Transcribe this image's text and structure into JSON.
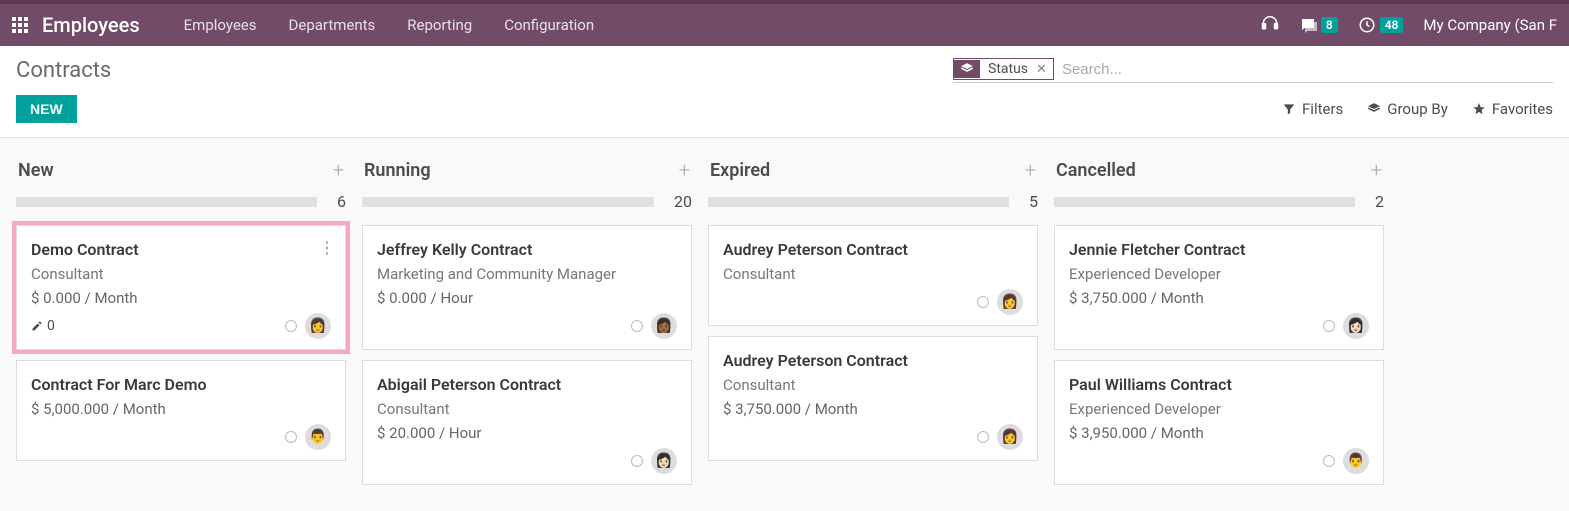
{
  "topbar": {
    "brand": "Employees",
    "nav": [
      "Employees",
      "Departments",
      "Reporting",
      "Configuration"
    ],
    "messages_badge": "8",
    "activities_badge": "48",
    "company": "My Company (San F"
  },
  "control_panel": {
    "breadcrumb": "Contracts",
    "new_btn": "NEW",
    "search_facet_label": "Status",
    "search_placeholder": "Search...",
    "filters_label": "Filters",
    "groupby_label": "Group By",
    "favorites_label": "Favorites"
  },
  "columns": [
    {
      "title": "New",
      "count": "6",
      "cards": [
        {
          "title": "Demo Contract",
          "subtitle": "Consultant",
          "wage": "$ 0.000 / Month",
          "highlighted": true,
          "has_menu": true,
          "sign_request": "0",
          "avatar_emoji": "👩"
        },
        {
          "title": "Contract For Marc Demo",
          "subtitle": "",
          "wage": "$ 5,000.000 / Month",
          "avatar_emoji": "👨"
        }
      ]
    },
    {
      "title": "Running",
      "count": "20",
      "cards": [
        {
          "title": "Jeffrey Kelly Contract",
          "subtitle": "Marketing and Community Manager",
          "wage": "$ 0.000 / Hour",
          "avatar_emoji": "👩🏾"
        },
        {
          "title": "Abigail Peterson Contract",
          "subtitle": "Consultant",
          "wage": "$ 20.000 / Hour",
          "avatar_emoji": "👩🏻"
        }
      ]
    },
    {
      "title": "Expired",
      "count": "5",
      "cards": [
        {
          "title": "Audrey Peterson Contract",
          "subtitle": "Consultant",
          "wage": "",
          "avatar_emoji": "👩"
        },
        {
          "title": "Audrey Peterson Contract",
          "subtitle": "Consultant",
          "wage": "$ 3,750.000 / Month",
          "avatar_emoji": "👩"
        }
      ]
    },
    {
      "title": "Cancelled",
      "count": "2",
      "cards": [
        {
          "title": "Jennie Fletcher Contract",
          "subtitle": "Experienced Developer",
          "wage": "$ 3,750.000 / Month",
          "avatar_emoji": "👩🏻"
        },
        {
          "title": "Paul Williams Contract",
          "subtitle": "Experienced Developer",
          "wage": "$ 3,950.000 / Month",
          "avatar_emoji": "👨"
        }
      ]
    }
  ]
}
